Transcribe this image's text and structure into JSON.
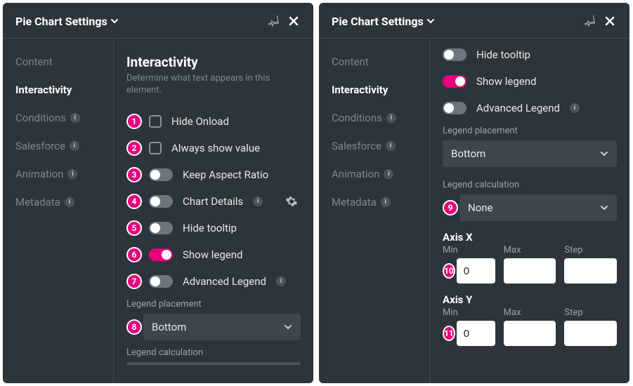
{
  "panels": [
    {
      "title": "Pie Chart Settings",
      "sidebar": [
        {
          "label": "Content",
          "active": false,
          "badge": false
        },
        {
          "label": "Interactivity",
          "active": true,
          "badge": false
        },
        {
          "label": "Conditions",
          "active": false,
          "badge": true
        },
        {
          "label": "Salesforce",
          "active": false,
          "badge": true
        },
        {
          "label": "Animation",
          "active": false,
          "badge": true
        },
        {
          "label": "Metadata",
          "active": false,
          "badge": true
        }
      ],
      "heading": "Interactivity",
      "subhead": "Determine what text appears in this element.",
      "controls": {
        "hide_onload": "Hide Onload",
        "always_show_value": "Always show value",
        "keep_aspect": "Keep Aspect Ratio",
        "chart_details": "Chart Details",
        "hide_tooltip": "Hide tooltip",
        "show_legend": "Show legend",
        "advanced_legend": "Advanced Legend",
        "legend_placement_label": "Legend placement",
        "legend_placement_value": "Bottom",
        "legend_calc_label": "Legend calculation"
      },
      "annotations": [
        "1",
        "2",
        "3",
        "4",
        "5",
        "6",
        "7",
        "8"
      ]
    },
    {
      "title": "Pie Chart Settings",
      "sidebar": [
        {
          "label": "Content",
          "active": false,
          "badge": false
        },
        {
          "label": "Interactivity",
          "active": true,
          "badge": false
        },
        {
          "label": "Conditions",
          "active": false,
          "badge": true
        },
        {
          "label": "Salesforce",
          "active": false,
          "badge": true
        },
        {
          "label": "Animation",
          "active": false,
          "badge": true
        },
        {
          "label": "Metadata",
          "active": false,
          "badge": true
        }
      ],
      "controls": {
        "hide_tooltip": "Hide tooltip",
        "show_legend": "Show legend",
        "advanced_legend": "Advanced Legend",
        "legend_placement_label": "Legend placement",
        "legend_placement_value": "Bottom",
        "legend_calc_label": "Legend calculation",
        "legend_calc_value": "None",
        "axis_x": {
          "title": "Axis X",
          "min_label": "Min",
          "max_label": "Max",
          "step_label": "Step",
          "min": "0",
          "max": "",
          "step": ""
        },
        "axis_y": {
          "title": "Axis Y",
          "min_label": "Min",
          "max_label": "Max",
          "step_label": "Step",
          "min": "0",
          "max": "",
          "step": ""
        }
      },
      "annotations": [
        "9",
        "10",
        "11"
      ]
    }
  ],
  "info_badge_glyph": "i"
}
